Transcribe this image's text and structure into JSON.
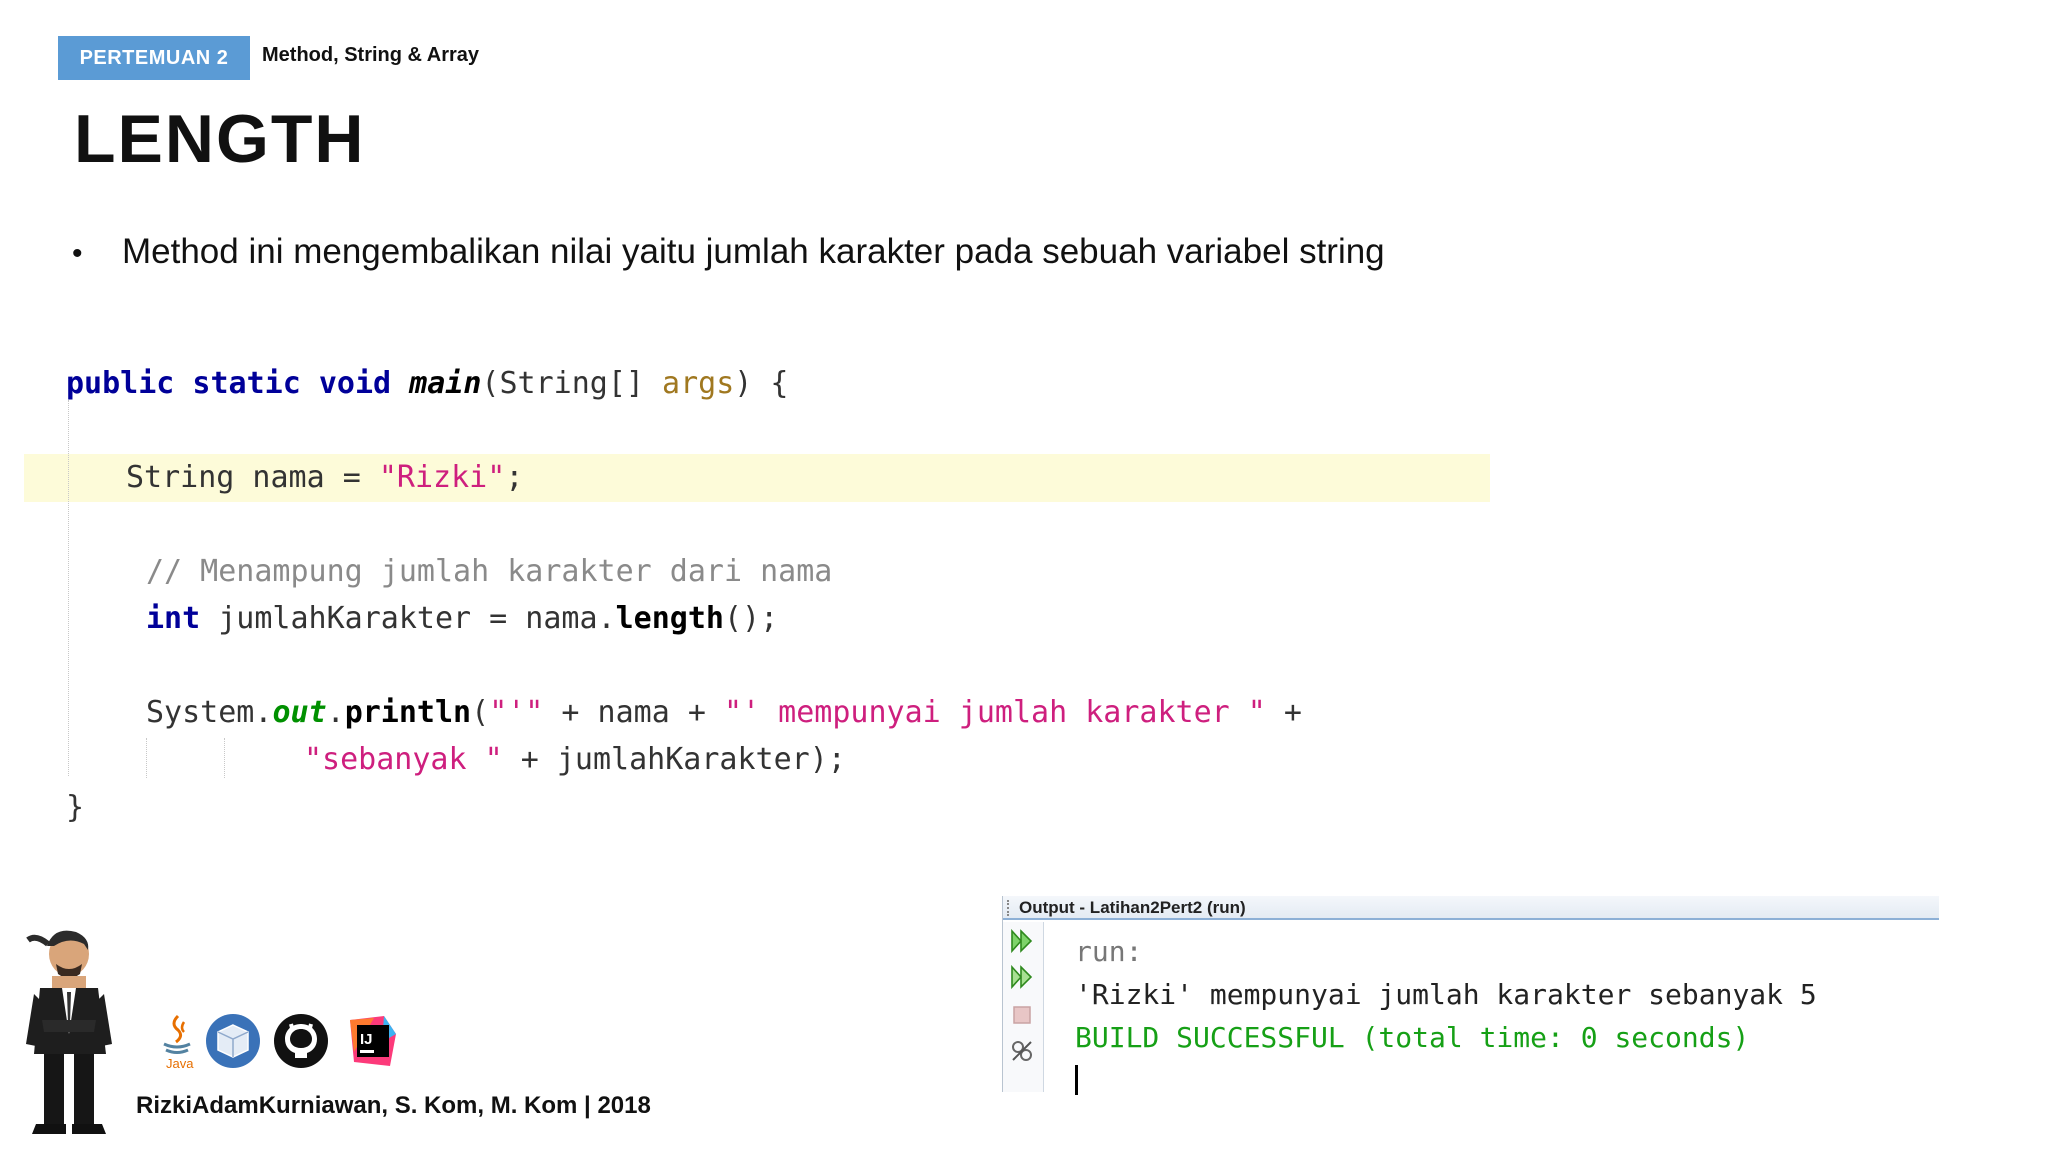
{
  "header": {
    "badge": "PERTEMUAN 2",
    "subject": "Method, String & Array"
  },
  "slide": {
    "title": "LENGTH",
    "bullet": "Method ini mengembalikan nilai yaitu jumlah karakter pada sebuah variabel string"
  },
  "code": {
    "l1": {
      "kw": "public static void",
      "method": "main",
      "open": "(String[]",
      "arg": "args",
      "close": ") {"
    },
    "l2": {
      "pre": "String nama = ",
      "str": "\"Rizki\"",
      "post": ";"
    },
    "l3": {
      "comment": "// Menampung jumlah karakter dari nama"
    },
    "l4": {
      "kw": "int",
      "mid": " jumlahKarakter = nama.",
      "method": "length",
      "post": "();"
    },
    "l5": {
      "pre": "System.",
      "field": "out",
      "dot": ".",
      "method": "println",
      "p1": "(",
      "s1": "\"'\"",
      "p2": " + nama + ",
      "s2": "\"' mempunyai jumlah karakter \"",
      "p3": " +"
    },
    "l6": {
      "str": "\"sebanyak \"",
      "post": " + jumlahKarakter);"
    },
    "l7": {
      "brace": "}"
    }
  },
  "output": {
    "title": "Output - Latihan2Pert2 (run)",
    "lines": [
      "run:",
      "'Rizki' mempunyai jumlah karakter sebanyak 5",
      "BUILD SUCCESSFUL (total time: 0 seconds)"
    ],
    "icons": [
      "rerun-icon",
      "rerun-with-options-icon",
      "stop-icon",
      "settings-icon"
    ]
  },
  "footer": {
    "author": "RizkiAdamKurniawan, S. Kom, M. Kom | 2018",
    "java_logo_text": "Java",
    "logos": [
      "java-logo-icon",
      "virtualbox-logo-icon",
      "github-logo-icon",
      "intellij-logo-icon"
    ]
  },
  "colors": {
    "badge": "#5b9bd5",
    "keyword": "#000099",
    "string": "#ce1f7e",
    "comment": "#8a8a8a",
    "highlight_row": "#fdfbd9",
    "success": "#16a016"
  }
}
